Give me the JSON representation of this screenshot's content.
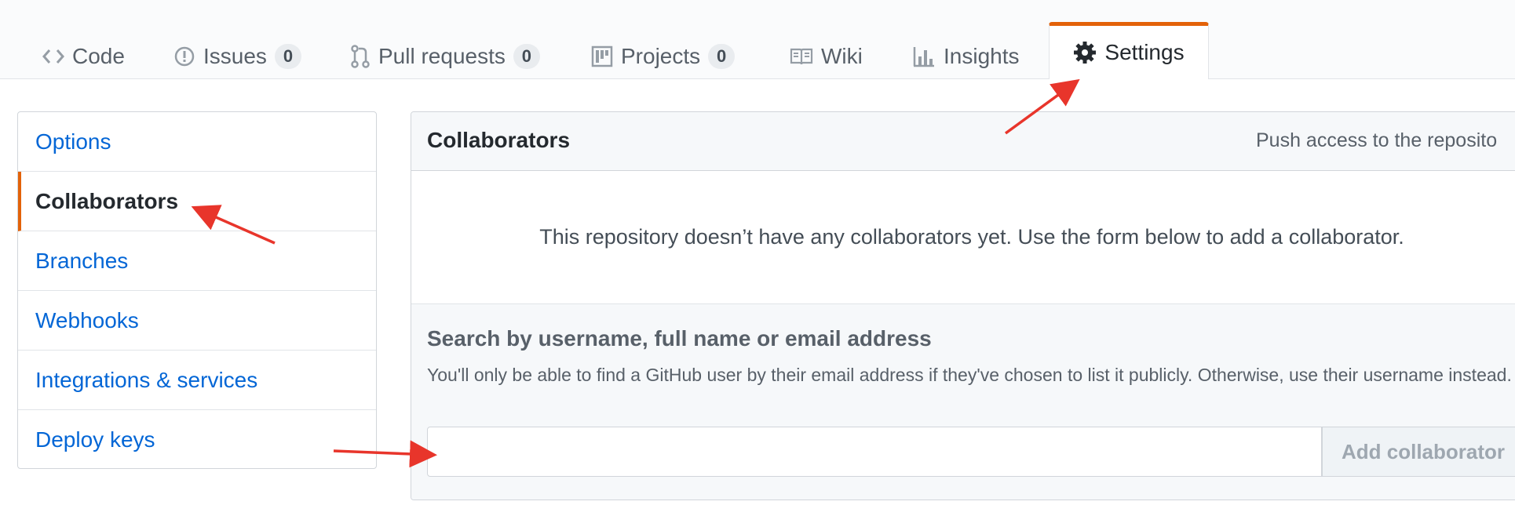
{
  "tabs": [
    {
      "label": "Code",
      "icon": "code-icon"
    },
    {
      "label": "Issues",
      "icon": "issue-icon",
      "count": "0"
    },
    {
      "label": "Pull requests",
      "icon": "pull-request-icon",
      "count": "0"
    },
    {
      "label": "Projects",
      "icon": "project-icon",
      "count": "0"
    },
    {
      "label": "Wiki",
      "icon": "book-icon"
    },
    {
      "label": "Insights",
      "icon": "graph-icon"
    },
    {
      "label": "Settings",
      "icon": "gear-icon",
      "selected": true
    }
  ],
  "sidebar": {
    "items": [
      {
        "label": "Options"
      },
      {
        "label": "Collaborators",
        "selected": true
      },
      {
        "label": "Branches"
      },
      {
        "label": "Webhooks"
      },
      {
        "label": "Integrations & services"
      },
      {
        "label": "Deploy keys"
      }
    ]
  },
  "panel": {
    "title": "Collaborators",
    "note": "Push access to the reposito",
    "empty_message": "This repository doesn’t have any collaborators yet. Use the form below to add a collaborator.",
    "search_title": "Search by username, full name or email address",
    "search_help": "You'll only be able to find a GitHub user by their email address if they've chosen to list it publicly. Otherwise, use their username instead.",
    "search_value": "",
    "add_button_label": "Add collaborator"
  },
  "colors": {
    "accent": "#e36209",
    "link": "#0366d6",
    "annotation_arrow": "#e8352b"
  }
}
